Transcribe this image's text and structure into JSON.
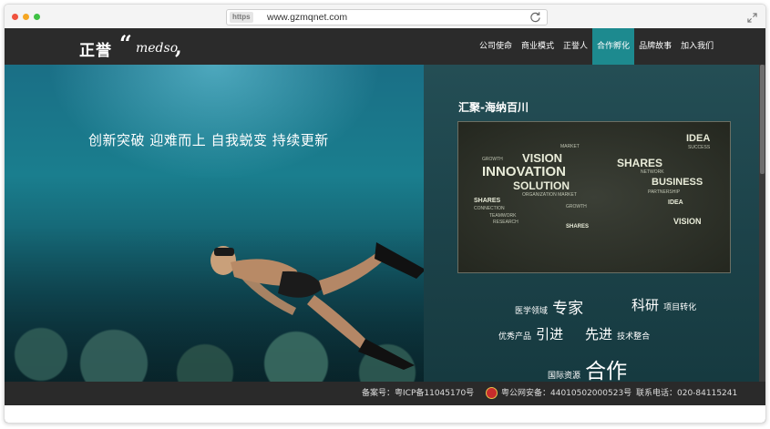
{
  "browser": {
    "https_label": "https",
    "url": "www.gzmqnet.com",
    "icons": [
      "reload-icon",
      "expand-icon"
    ]
  },
  "logo": {
    "chinese": "正誉",
    "open_quote": "“",
    "english": "medso",
    "close_quote": ","
  },
  "nav": {
    "items": [
      {
        "label": "公司使命",
        "active": false
      },
      {
        "label": "商业模式",
        "active": false
      },
      {
        "label": "正誉人",
        "active": false
      },
      {
        "label": "合作孵化",
        "active": true
      },
      {
        "label": "品牌故事",
        "active": false
      },
      {
        "label": "加入我们",
        "active": false
      }
    ]
  },
  "hero": {
    "slogan": "创新突破 迎难而上 自我蜕变 持续更新",
    "panel_title": "汇聚-海纳百川",
    "map_words": {
      "innovation": "INNOVATION",
      "vision": "VISION",
      "solution": "SOLUTION",
      "shares": "SHARES",
      "business": "BUSINESS",
      "idea": "IDEA",
      "vision2": "VISION",
      "growth": "GROWTH",
      "market": "MARKET",
      "organization": "ORGANIZATION MARKET",
      "connection": "CONNECTION",
      "network": "NETWORK",
      "success": "SUCCESS",
      "teamwork": "TEAMWORK",
      "partnership": "PARTNERSHIP",
      "shares2": "SHARES",
      "growth2": "GROWTH",
      "research": "RESEARCH",
      "shares3": "SHARES",
      "idea2": "IDEA"
    },
    "keywords": {
      "k1_small": "医学领域",
      "k1_large": "专家",
      "k2_large": "科研",
      "k2_small": "项目转化",
      "k3_small": "优秀产品",
      "k3_large": "引进",
      "k4_large": "先进",
      "k4_small": "技术整合",
      "k5_small": "国际资源",
      "k5_large": "合作"
    }
  },
  "footer": {
    "icp": "备案号：粤ICP备11045170号",
    "police": "粤公网安备：44010502000523号",
    "phone": "联系电话：020-84115241"
  },
  "colors": {
    "accent": "#1d8a8f",
    "nav_bg": "#2b2b2b",
    "footer_bg": "#2a2a2a"
  }
}
